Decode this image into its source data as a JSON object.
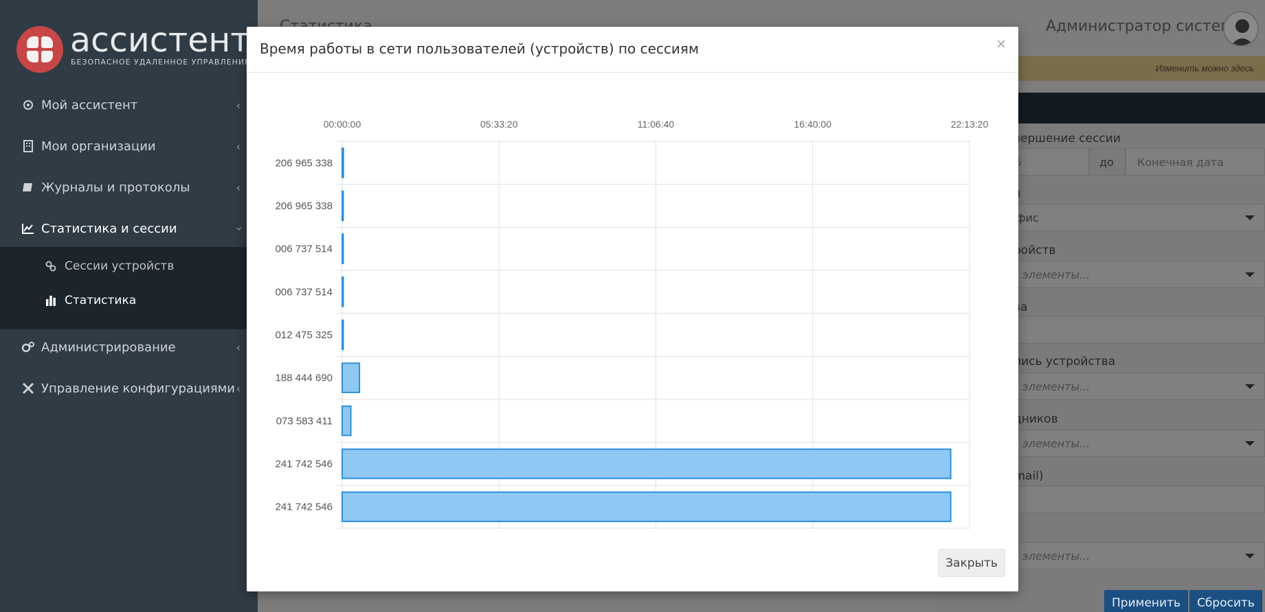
{
  "app": {
    "logo_title": "ассистент",
    "logo_subtitle": "БЕЗОПАСНОЕ УДАЛЕННОЕ УПРАВЛЕНИЕ",
    "page_title": "Статистика",
    "user_name": "Администратор системы"
  },
  "sidebar": {
    "items": [
      {
        "label": "Мой ассистент",
        "icon": "gear-icon"
      },
      {
        "label": "Мои организации",
        "icon": "building-icon"
      },
      {
        "label": "Журналы и протоколы",
        "icon": "book-icon"
      },
      {
        "label": "Статистика и сессии",
        "icon": "chart-line-icon"
      },
      {
        "label": "Администрирование",
        "icon": "gears-icon"
      },
      {
        "label": "Управление конфигурациями",
        "icon": "tools-icon"
      }
    ],
    "subitems": [
      {
        "label": "Сессии устройств",
        "icon": "link-icon"
      },
      {
        "label": "Статистика",
        "icon": "bar-chart-icon"
      }
    ]
  },
  "background": {
    "notice": "Изменить можно здесь",
    "filters": {
      "session_end_label": "вершение сессии",
      "date_from_value": "5",
      "date_to_label": "до",
      "date_end_placeholder": "Конечная дата",
      "label_2": "я",
      "office_value": "офис",
      "label_3": "ройств",
      "placeholder_select": "е элементы...",
      "label_4": "ва",
      "label_5": "пись устройства",
      "label_6": "дников",
      "label_7": "email)",
      "apply_button": "Применить",
      "reset_button": "Сбросить"
    }
  },
  "modal": {
    "title": "Время работы в сети пользователей (устройств) по сессиям",
    "close_symbol": "×",
    "close_button": "Закрыть"
  },
  "chart_data": {
    "type": "bar",
    "orientation": "horizontal",
    "x_ticks": [
      "00:00:00",
      "05:33:20",
      "11:06:40",
      "16:40:00",
      "22:13:20"
    ],
    "x_tick_seconds": [
      0,
      20000,
      40000,
      60000,
      80000
    ],
    "xlim": [
      0,
      80000
    ],
    "categories": [
      "206 965 338",
      "206 965 338",
      "006 737 514",
      "006 737 514",
      "012 475 325",
      "188 444 690",
      "073 583 411",
      "241 742 546",
      "241 742 546"
    ],
    "values": [
      150,
      60,
      40,
      40,
      70,
      2200,
      1100,
      77600,
      77600
    ],
    "unit": "seconds",
    "colors": {
      "fill": "#90c8f4",
      "stroke": "#2b8fe0",
      "grid": "#e1e1e1"
    }
  }
}
